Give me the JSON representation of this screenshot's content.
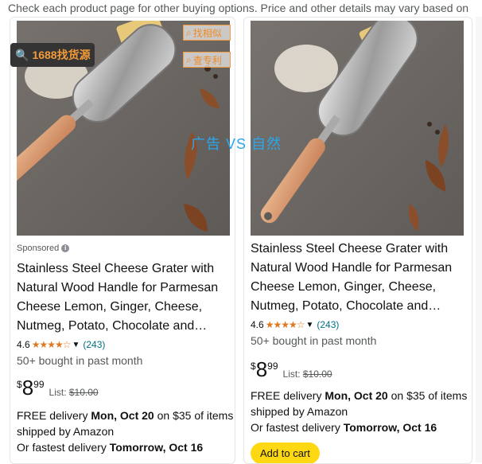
{
  "top_notice": "Check each product page for other buying options. Price and other details may vary based on",
  "overlay": {
    "badge_text": "1688找货源",
    "find_similar": "找相似",
    "patent_check": "查专利",
    "vs_text": "广告 VS 自然"
  },
  "products": [
    {
      "sponsored_label": "Sponsored",
      "title": "Stainless Steel Cheese Grater with Natural Wood Handle for Parmesan Cheese Lemon, Ginger, Cheese, Nutmeg, Potato, Chocolate and…",
      "rating": "4.6",
      "stars_glyphs": "★★★★☆",
      "rating_count": "(243)",
      "bought": "50+ bought in past month",
      "price_symbol": "$",
      "price_whole": "8",
      "price_fraction": "99",
      "list_label": "List:",
      "list_price": "$10.00",
      "delivery_prefix": "FREE delivery",
      "delivery_date": "Mon, Oct 20",
      "delivery_suffix": "on $35 of items shipped by Amazon",
      "fastest_prefix": "Or fastest delivery",
      "fastest_date": "Tomorrow, Oct 16"
    },
    {
      "title": "Stainless Steel Cheese Grater with Natural Wood Handle for Parmesan Cheese Lemon, Ginger, Cheese, Nutmeg, Potato, Chocolate and…",
      "rating": "4.6",
      "stars_glyphs": "★★★★☆",
      "rating_count": "(243)",
      "bought": "50+ bought in past month",
      "price_symbol": "$",
      "price_whole": "8",
      "price_fraction": "99",
      "list_label": "List:",
      "list_price": "$10.00",
      "delivery_prefix": "FREE delivery",
      "delivery_date": "Mon, Oct 20",
      "delivery_suffix": "on $35 of items shipped by Amazon",
      "fastest_prefix": "Or fastest delivery",
      "fastest_date": "Tomorrow, Oct 16",
      "add_to_cart": "Add to cart"
    }
  ],
  "colors": {
    "star": "#de7921",
    "link": "#007185",
    "cart_button": "#ffd814",
    "badge_bg": "#343434",
    "badge_text": "#f39a3a",
    "overlay_blue": "#2aa7ee"
  }
}
